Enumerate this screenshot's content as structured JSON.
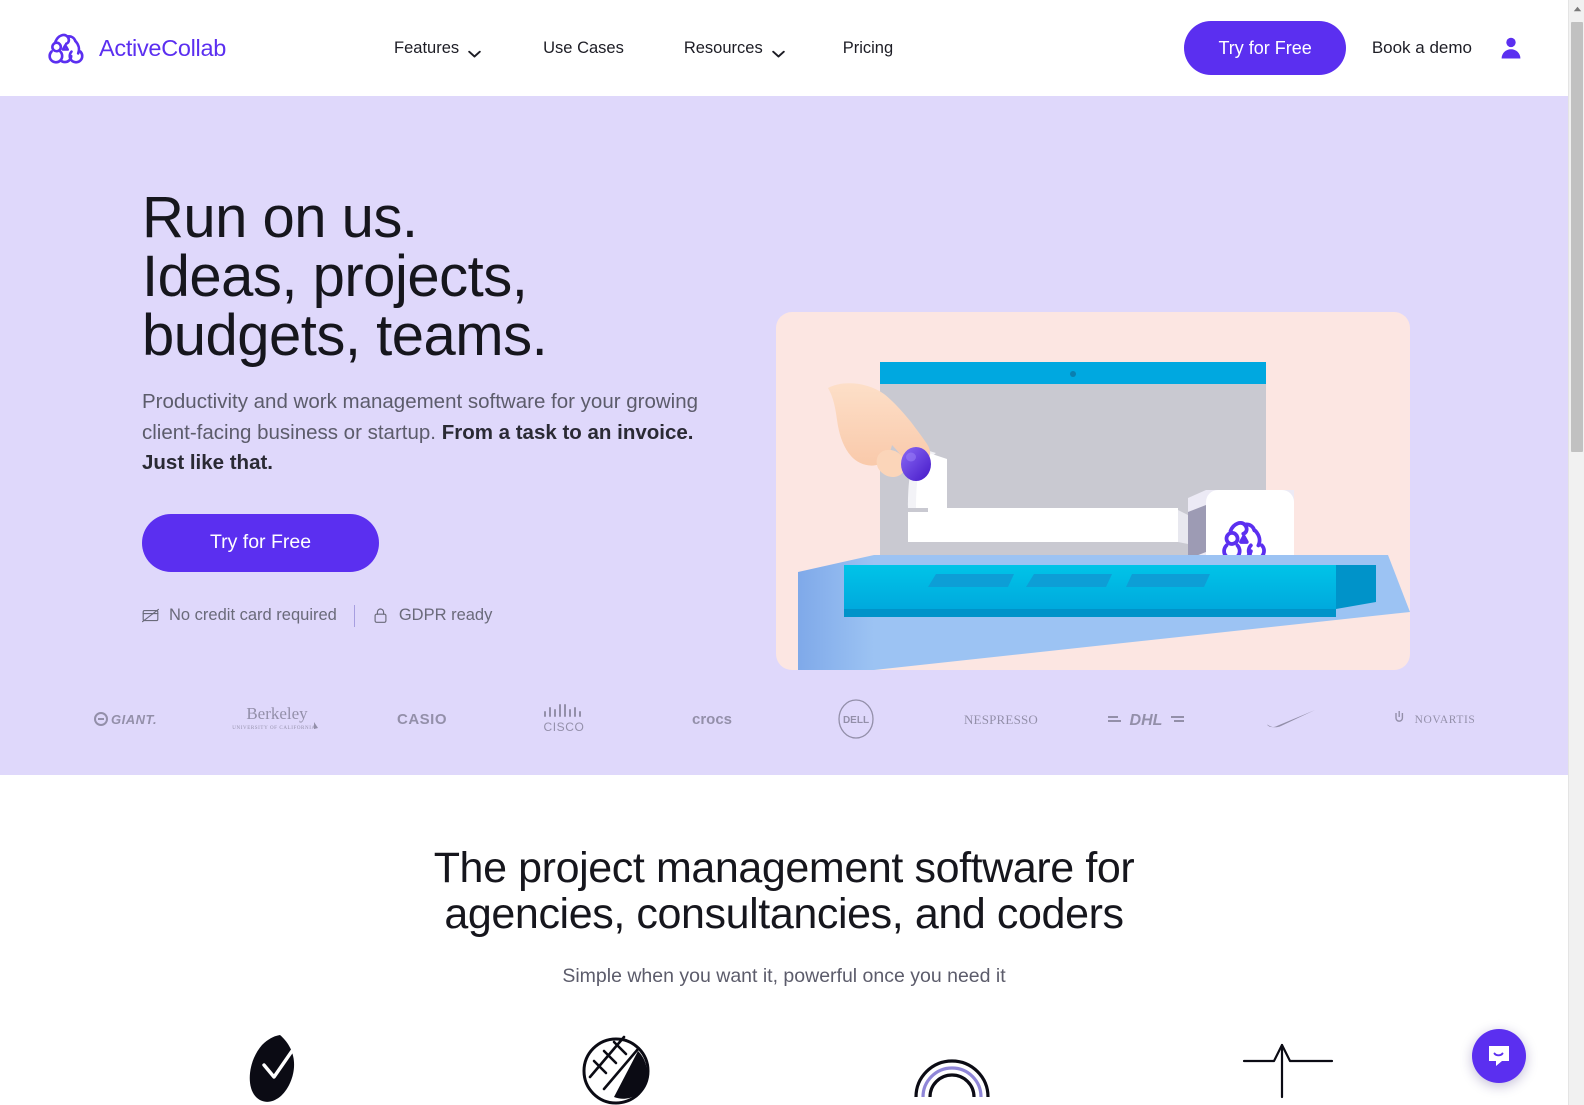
{
  "brand": {
    "name": "ActiveCollab",
    "logo_icon": "activecollab-logo-icon",
    "accent_color": "#5b2ff0"
  },
  "header": {
    "nav": [
      {
        "label": "Features",
        "has_dropdown": true,
        "icon": "chevron-down-icon"
      },
      {
        "label": "Use Cases",
        "has_dropdown": false
      },
      {
        "label": "Resources",
        "has_dropdown": true,
        "icon": "chevron-down-icon"
      },
      {
        "label": "Pricing",
        "has_dropdown": false
      }
    ],
    "cta_label": "Try for Free",
    "book_demo_label": "Book a demo",
    "account_icon": "user-avatar-icon"
  },
  "hero": {
    "background_color": "#dfd8fb",
    "title_lines": [
      "Run on us.",
      "Ideas, projects,",
      "budgets, teams."
    ],
    "subtitle_regular": "Productivity and work management software for your growing client-facing business or startup. ",
    "subtitle_bold": "From a task to an invoice. Just like that.",
    "cta_label": "Try for Free",
    "trust": [
      {
        "label": "No credit card required",
        "icon": "no-credit-card-icon"
      },
      {
        "label": "GDPR ready",
        "icon": "lock-icon"
      }
    ],
    "illustration": {
      "name": "laptop-hand-ball-illustration",
      "card_color": "#fce6e2",
      "laptop_top_color": "#00a8e0",
      "laptop_base_color": "#00bde0",
      "desk_color": "#7aa6e8",
      "ball_color": "#5b2ff0",
      "screen_color": "#cfcfd6"
    }
  },
  "logo_strip": [
    {
      "name": "giant-logo",
      "text": "GIANT"
    },
    {
      "name": "berkeley-logo",
      "text": "Berkeley",
      "sub": "UNIVERSITY OF CALIFORNIA"
    },
    {
      "name": "casio-logo",
      "text": "CASIO"
    },
    {
      "name": "cisco-logo",
      "text": "CISCO"
    },
    {
      "name": "crocs-logo",
      "text": "crocs"
    },
    {
      "name": "dell-logo",
      "text": "DELL"
    },
    {
      "name": "nespresso-logo",
      "text": "NESPRESSO"
    },
    {
      "name": "dhl-logo",
      "text": "DHL"
    },
    {
      "name": "nike-logo",
      "text": ""
    },
    {
      "name": "novartis-logo",
      "text": "NOVARTIS"
    }
  ],
  "section2": {
    "title_lines": [
      "The project management software for",
      "agencies, consultancies, and coders"
    ],
    "subtitle": "Simple when you want it, powerful once you need it",
    "feature_icons": [
      "checkmark-leaf-icon",
      "ladder-circle-icon",
      "arch-rainbow-icon",
      "peak-line-icon"
    ]
  },
  "chat": {
    "icon": "chat-bubble-smile-icon",
    "color": "#5b2ff0"
  },
  "scrollbar": {
    "up_arrow_icon": "scroll-up-arrow-icon"
  }
}
